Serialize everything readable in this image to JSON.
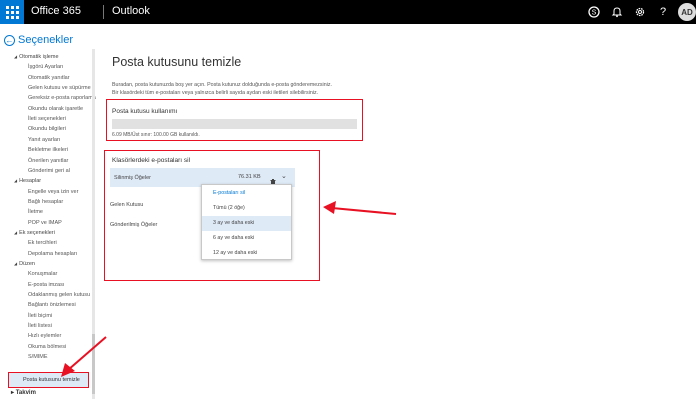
{
  "topbar": {
    "brand": "Office 365",
    "app": "Outlook",
    "avatar": "AD",
    "help": "?"
  },
  "sidebar": {
    "title": "Seçenekler",
    "items": [
      {
        "label": "Otomatik işleme",
        "kind": "group"
      },
      {
        "label": "İşgörü Ayarları",
        "kind": "sub"
      },
      {
        "label": "Otomatik yanıtlar",
        "kind": "sub"
      },
      {
        "label": "Gelen kutusu ve süpürme",
        "kind": "sub"
      },
      {
        "label": "Gereksiz e-posta raporlama",
        "kind": "sub"
      },
      {
        "label": "Okundu olarak işaretle",
        "kind": "sub"
      },
      {
        "label": "İleti seçenekleri",
        "kind": "sub"
      },
      {
        "label": "Okundu bilgileri",
        "kind": "sub"
      },
      {
        "label": "Yanıt ayarları",
        "kind": "sub"
      },
      {
        "label": "Bekletme ilkeleri",
        "kind": "sub"
      },
      {
        "label": "Önerilen yanıtlar",
        "kind": "sub"
      },
      {
        "label": "Gönderimi geri al",
        "kind": "sub"
      },
      {
        "label": "Hesaplar",
        "kind": "group"
      },
      {
        "label": "Engelle veya izin ver",
        "kind": "sub"
      },
      {
        "label": "Bağlı hesaplar",
        "kind": "sub"
      },
      {
        "label": "İletme",
        "kind": "sub"
      },
      {
        "label": "POP ve IMAP",
        "kind": "sub"
      },
      {
        "label": "Ek seçenekleri",
        "kind": "group"
      },
      {
        "label": "Ek tercihleri",
        "kind": "sub"
      },
      {
        "label": "Depolama hesapları",
        "kind": "sub"
      },
      {
        "label": "Düzen",
        "kind": "group"
      },
      {
        "label": "Konuşmalar",
        "kind": "sub"
      },
      {
        "label": "E-posta imzası",
        "kind": "sub"
      },
      {
        "label": "Odaklanmış gelen kutusu",
        "kind": "sub"
      },
      {
        "label": "Bağlantı önizlemesi",
        "kind": "sub"
      },
      {
        "label": "İleti biçimi",
        "kind": "sub"
      },
      {
        "label": "İleti listesi",
        "kind": "sub"
      },
      {
        "label": "Hızlı eylemler",
        "kind": "sub"
      },
      {
        "label": "Okuma bölmesi",
        "kind": "sub"
      },
      {
        "label": "S/MIME",
        "kind": "sub"
      }
    ],
    "selected": "Posta kutusunu temizle",
    "calendar": "Takvim"
  },
  "main": {
    "title": "Posta kutusunu temizle",
    "description_1": "Buradan, posta kutunuzda boş yer açın. Posta kutunuz dolduğunda e-posta gönderemezsiniz.",
    "description_2": "Bir klasördeki tüm e-postaları veya yalnızca belirli sayıda aydan eski iletileri silebilirsiniz.",
    "usage": {
      "title": "Posta kutusu kullanımı",
      "text": "6.09 MB/Üst sınır: 100.00 GB kullanıldı.",
      "used_fraction": 0.0001
    },
    "folders_title": "Klasörlerdeki e-postaları sil",
    "folders": [
      {
        "name": "Silinmiş Öğeler",
        "size": "76.31 KB"
      },
      {
        "name": "Gelen Kutusu"
      },
      {
        "name": "Gönderilmiş Öğeler"
      }
    ],
    "dropdown": [
      "E-postaları sil",
      "Tümü (2 öğe)",
      "3 ay ve daha eski",
      "6 ay ve daha eski",
      "12 ay ve daha eski"
    ]
  },
  "colors": {
    "accent": "#0078d4",
    "highlight": "#e81123",
    "selected_bg": "#dfeaf7"
  }
}
